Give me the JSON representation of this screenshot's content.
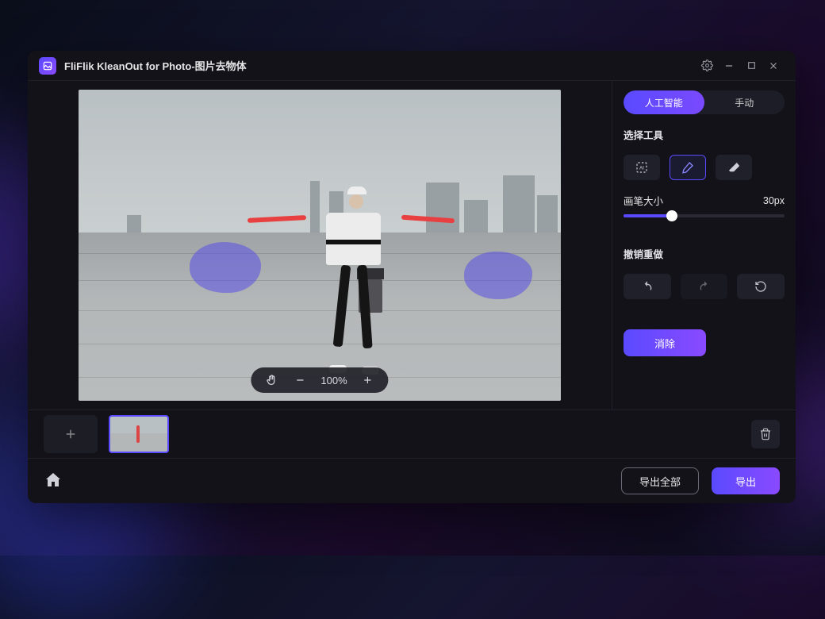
{
  "titlebar": {
    "title": "FliFlik KleanOut for Photo-图片去物体"
  },
  "zoom": {
    "level": "100%"
  },
  "sidepanel": {
    "tabs": {
      "ai": "人工智能",
      "manual": "手动"
    },
    "select_tool_label": "选择工具",
    "brush_size_label": "画笔大小",
    "brush_size_value": "30px",
    "undo_redo_label": "撤销重做",
    "erase_button": "消除"
  },
  "footer": {
    "export_all": "导出全部",
    "export": "导出"
  }
}
